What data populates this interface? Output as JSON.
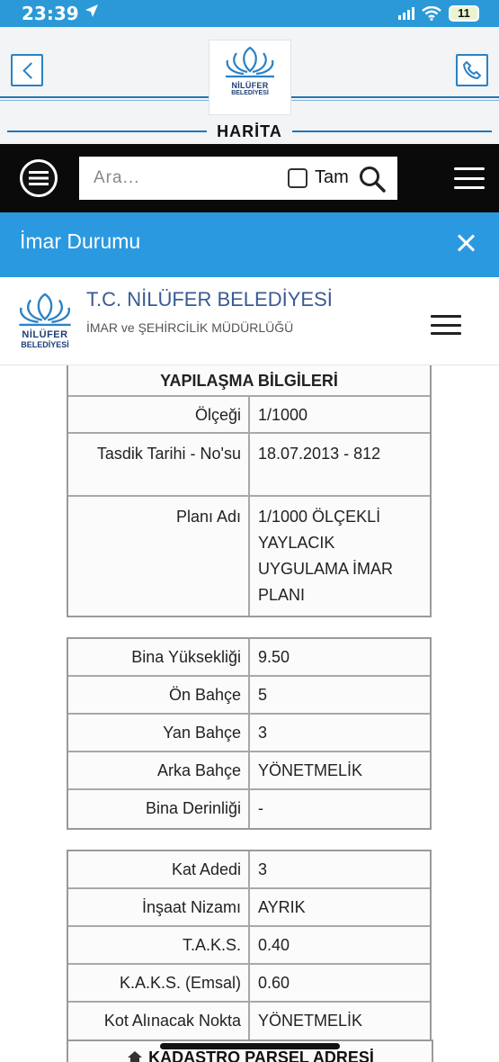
{
  "status_bar": {
    "time": "23:39",
    "battery": "11"
  },
  "header": {
    "logo_line1": "NİLÜFER",
    "logo_line2": "BELEDİYESİ",
    "map_label": "HARİTA"
  },
  "search": {
    "placeholder": "Ara...",
    "exact_label": "Tam"
  },
  "modal": {
    "title": "İmar Durumu"
  },
  "municipality": {
    "title": "T.C. NİLÜFER BELEDİYESİ",
    "subtitle": "İMAR ve ŞEHİRCİLİK MÜDÜRLÜĞÜ",
    "logo_line1": "NİLÜFER",
    "logo_line2": "BELEDİYESİ"
  },
  "section1": {
    "heading": "YAPILAŞMA BİLGİLERİ",
    "rows": [
      {
        "label": "Ölçeği",
        "value": "1/1000"
      },
      {
        "label": "Tasdik Tarihi - No'su",
        "value": "18.07.2013 - 812"
      },
      {
        "label": "Planı Adı",
        "value": "1/1000 ÖLÇEKLİ YAYLACIK UYGULAMA İMAR PLANI"
      }
    ]
  },
  "section2": {
    "rows": [
      {
        "label": "Bina Yüksekliği",
        "value": "9.50"
      },
      {
        "label": "Ön Bahçe",
        "value": "5"
      },
      {
        "label": "Yan Bahçe",
        "value": "3"
      },
      {
        "label": "Arka Bahçe",
        "value": "YÖNETMELİK"
      },
      {
        "label": "Bina Derinliği",
        "value": "-"
      }
    ]
  },
  "section3": {
    "rows": [
      {
        "label": "Kat Adedi",
        "value": "3"
      },
      {
        "label": "İnşaat Nizamı",
        "value": "AYRIK"
      },
      {
        "label": "T.A.K.S.",
        "value": "0.40"
      },
      {
        "label": "K.A.K.S. (Emsal)",
        "value": "0.60"
      },
      {
        "label": "Kot Alınacak Nokta",
        "value": "YÖNETMELİK"
      }
    ]
  },
  "section4": {
    "heading": "KADASTRO PARSEL ADRESİ"
  },
  "colors": {
    "brand_blue": "#2b99e0",
    "header_rule": "#2376b8",
    "logo_navy": "#1d3e77"
  }
}
